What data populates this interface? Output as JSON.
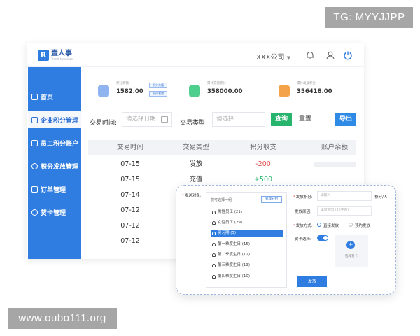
{
  "watermarks": {
    "top": "TG: MYYJJPP",
    "bottom": "www.oubo111.org"
  },
  "header": {
    "brand_mark": "R",
    "brand_name": "壹人事",
    "brand_sub": "TrendHumanize",
    "company": "XXX公司",
    "dropdown_glyph": "▼"
  },
  "sidebar": {
    "items": [
      {
        "label": "首页",
        "active": false
      },
      {
        "label": "企业积分管理",
        "active": true
      },
      {
        "label": "员工积分账户",
        "active": false
      },
      {
        "label": "积分发放管理",
        "active": false
      },
      {
        "label": "订单管理",
        "active": false
      },
      {
        "label": "贺卡管理",
        "active": false
      }
    ]
  },
  "stats": [
    {
      "label": "积分余额",
      "value": "1582.00",
      "color": "#8fb4f0"
    },
    {
      "label": "累计充值积分",
      "value": "358000.00",
      "color": "#4fcf8d"
    },
    {
      "label": "累计发放积分",
      "value": "356418.00",
      "color": "#f5a34a"
    }
  ],
  "stat_buttons": [
    "积分充值",
    "积分发放"
  ],
  "filters": {
    "time_label": "交易时间:",
    "date_placeholder": "请选择日期",
    "type_label": "交易类型:",
    "type_placeholder": "请选择",
    "query": "查询",
    "reset": "重置",
    "export": "导出"
  },
  "table": {
    "headers": [
      "交易时间",
      "交易类型",
      "积分收支",
      "账户余额"
    ],
    "rows": [
      {
        "date": "07-15",
        "type": "发放",
        "amount": "-200",
        "sign": "neg"
      },
      {
        "date": "07-15",
        "type": "充值",
        "amount": "+500",
        "sign": "pos"
      },
      {
        "date": "07-14",
        "type": "",
        "amount": "",
        "sign": ""
      },
      {
        "date": "07-12",
        "type": "",
        "amount": "",
        "sign": ""
      },
      {
        "date": "07-12",
        "type": "",
        "amount": "",
        "sign": ""
      },
      {
        "date": "07-12",
        "type": "",
        "amount": "",
        "sign": ""
      }
    ]
  },
  "dialog": {
    "target_label": "发送对象:",
    "select_hint": "仅可选择一组",
    "manage_group": "管理分组",
    "groups": [
      {
        "label": "男性员工 (21)",
        "selected": false
      },
      {
        "label": "女性员工 (29)",
        "selected": false
      },
      {
        "label": "实习期 (5)",
        "selected": true
      },
      {
        "label": "第一季度生日 (15)",
        "selected": false
      },
      {
        "label": "第二季度生日 (12)",
        "selected": false
      },
      {
        "label": "第三季度生日 (13)",
        "selected": false
      },
      {
        "label": "第四季度生日 (10)",
        "selected": false
      }
    ],
    "points_label": "发放积分:",
    "points_placeholder": "请输入",
    "points_unit": "积分/人",
    "reason_label": "发放原因:",
    "reason_placeholder": "填写原因 (20字内)",
    "method_label": "发放方式:",
    "method_options": [
      "直接发放",
      "预约发放"
    ],
    "card_label": "贺卡选择:",
    "card_action": "选择贺卡",
    "submit": "发放"
  }
}
